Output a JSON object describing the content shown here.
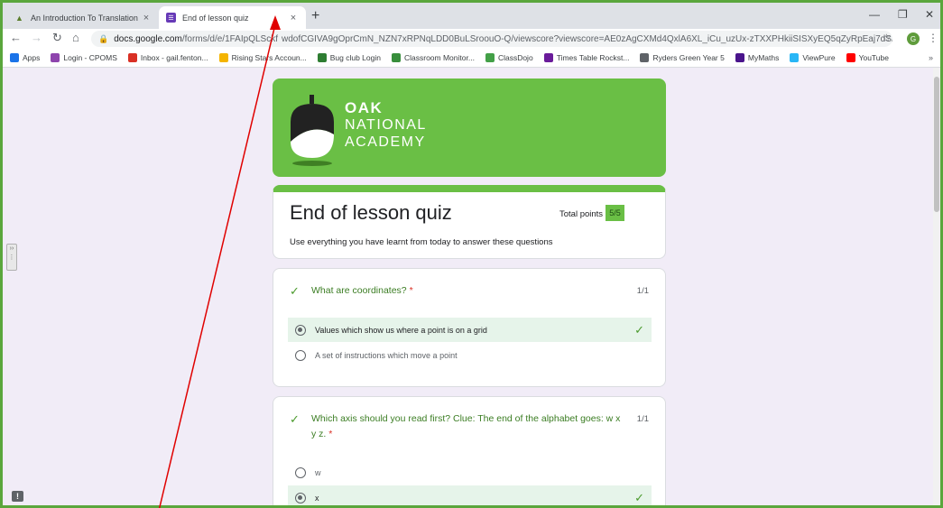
{
  "browser": {
    "tabs": [
      {
        "title": "An Introduction To Translation | ",
        "close": "×"
      },
      {
        "title": "End of lesson quiz",
        "close": "×"
      }
    ],
    "new_tab": "+",
    "url_host": "docs.google.com",
    "url_rest": "/forms/d/e/1FAIpQLSckf  wdofCGIVA9gOprCmN_NZN7xRPNqLDD0BuLSroouO-Q/viewscore?viewscore=AE0zAgCXMd4QxlA6XL_iCu_uzUx-zTXXPHkiiSISXyEQ5qZyRpEaj7dSAd8gdD...",
    "profile_initial": "G",
    "bookmarks": [
      {
        "label": "Apps",
        "icon": "apps-grid-icon",
        "color": "#1a73e8"
      },
      {
        "label": "Login - CPOMS",
        "icon": "cpoms-icon",
        "color": "#8e44ad"
      },
      {
        "label": "Inbox - gail.fenton...",
        "icon": "gmail-icon",
        "color": "#d93025"
      },
      {
        "label": "Rising Stars Accoun...",
        "icon": "rising-stars-icon",
        "color": "#f4b400"
      },
      {
        "label": "Bug club Login",
        "icon": "bug-club-icon",
        "color": "#2e7d32"
      },
      {
        "label": "Classroom Monitor...",
        "icon": "classroom-monitor-icon",
        "color": "#388e3c"
      },
      {
        "label": "ClassDojo",
        "icon": "classdojo-icon",
        "color": "#43a047"
      },
      {
        "label": "Times Table Rockst...",
        "icon": "ttrockstars-icon",
        "color": "#6a1b9a"
      },
      {
        "label": "Ryders Green Year 5",
        "icon": "globe-icon",
        "color": "#5f6368"
      },
      {
        "label": "MyMaths",
        "icon": "mymaths-icon",
        "color": "#4a148c"
      },
      {
        "label": "ViewPure",
        "icon": "viewpure-icon",
        "color": "#29b6f6"
      },
      {
        "label": "YouTube",
        "icon": "youtube-icon",
        "color": "#ff0000"
      }
    ],
    "bookmarks_more": "»"
  },
  "banner": {
    "line1": "OAK",
    "line2": "NATIONAL",
    "line3": "ACADEMY"
  },
  "quiz": {
    "title": "End of lesson quiz",
    "description": "Use everything you have learnt from today to answer these questions",
    "total_label": "Total points",
    "total_value": "5/5",
    "questions": [
      {
        "text": "What are coordinates?",
        "required_mark": "*",
        "score": "1/1",
        "options": [
          {
            "label": "Values which show us where a point is on a grid",
            "selected": true,
            "correct": true
          },
          {
            "label": "A set of instructions which move a point",
            "selected": false,
            "correct": false
          }
        ]
      },
      {
        "text": "Which axis should you read first? Clue: The end of the alphabet goes: w x y z.",
        "required_mark": "*",
        "score": "1/1",
        "options": [
          {
            "label": "w",
            "selected": false,
            "correct": false
          },
          {
            "label": "x",
            "selected": true,
            "correct": true
          }
        ]
      }
    ]
  },
  "colors": {
    "oak_green": "#6abf45",
    "correct_bg": "#e6f4ea",
    "correct_text": "#3b7d23",
    "annotation_red": "#e00000"
  }
}
